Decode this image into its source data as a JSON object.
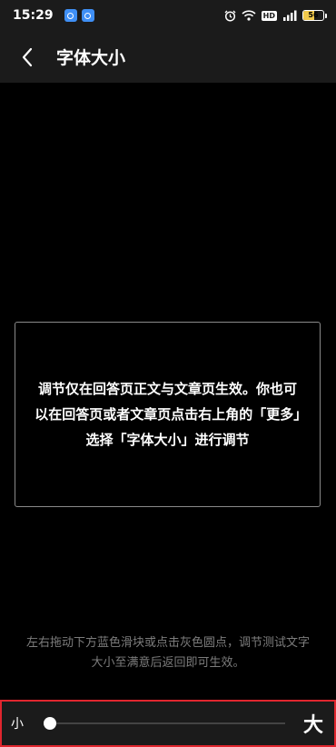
{
  "status_bar": {
    "time": "15:29",
    "hd_label": "HD",
    "battery_level": "56",
    "battery_fraction": 0.56,
    "battery_color": "#f2c94c"
  },
  "header": {
    "back_icon": "chevron-left-icon",
    "title": "字体大小"
  },
  "preview": {
    "text": "调节仅在回答页正文与文章页生效。你也可以在回答页或者文章页点击右上角的「更多」选择「字体大小」进行调节"
  },
  "hint": {
    "text": "左右拖动下方蓝色滑块或点击灰色圆点，调节测试文字大小至满意后返回即可生效。"
  },
  "font_slider": {
    "small_label": "小",
    "large_label": "大",
    "value_fraction": 0.0,
    "highlight_color": "#e0262e"
  }
}
